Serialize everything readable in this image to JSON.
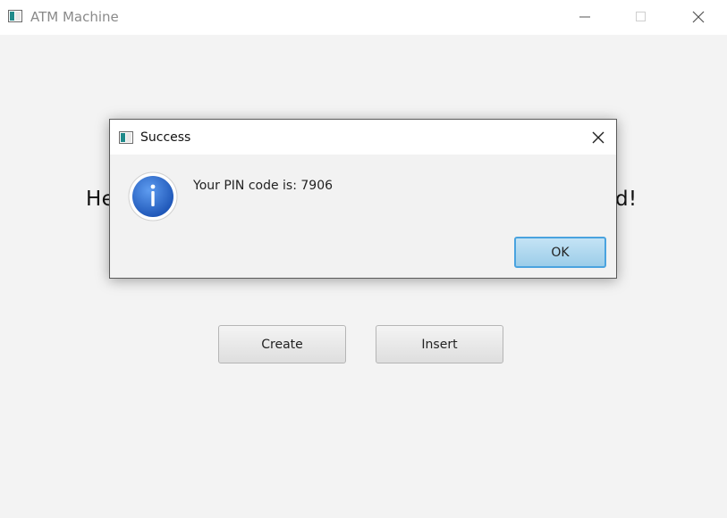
{
  "window": {
    "title": "ATM Machine"
  },
  "main": {
    "greeting_left": "He",
    "greeting_right": "d!",
    "buttons": {
      "create": "Create",
      "insert": "Insert"
    }
  },
  "dialog": {
    "title": "Success",
    "message": "Your PIN code is: 7906",
    "ok_label": "OK",
    "icon": "info-icon"
  },
  "colors": {
    "background": "#f3f3f3",
    "titlebar": "#ffffff",
    "ok_accent": "#4aa3df",
    "info_blue": "#2f6fd0"
  }
}
